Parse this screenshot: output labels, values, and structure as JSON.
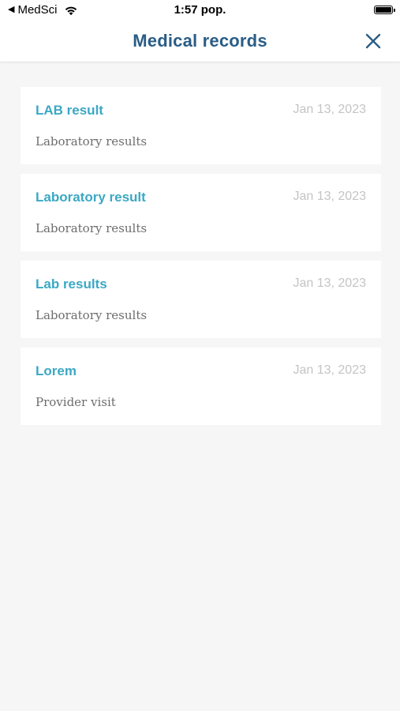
{
  "status_bar": {
    "carrier": "MedSci",
    "time": "1:57 pop."
  },
  "header": {
    "title": "Medical records",
    "close_icon": "close-icon"
  },
  "colors": {
    "title": "#2a5d86",
    "record_title": "#3ba8c4",
    "date": "#c4c4c4",
    "background": "#f6f6f6"
  },
  "records": [
    {
      "title": "LAB result",
      "date": "Jan 13, 2023",
      "type": "Laboratory results"
    },
    {
      "title": "Laboratory result",
      "date": "Jan 13, 2023",
      "type": "Laboratory results"
    },
    {
      "title": "Lab results",
      "date": "Jan 13, 2023",
      "type": "Laboratory results"
    },
    {
      "title": "Lorem",
      "date": "Jan 13, 2023",
      "type": "Provider visit"
    }
  ]
}
